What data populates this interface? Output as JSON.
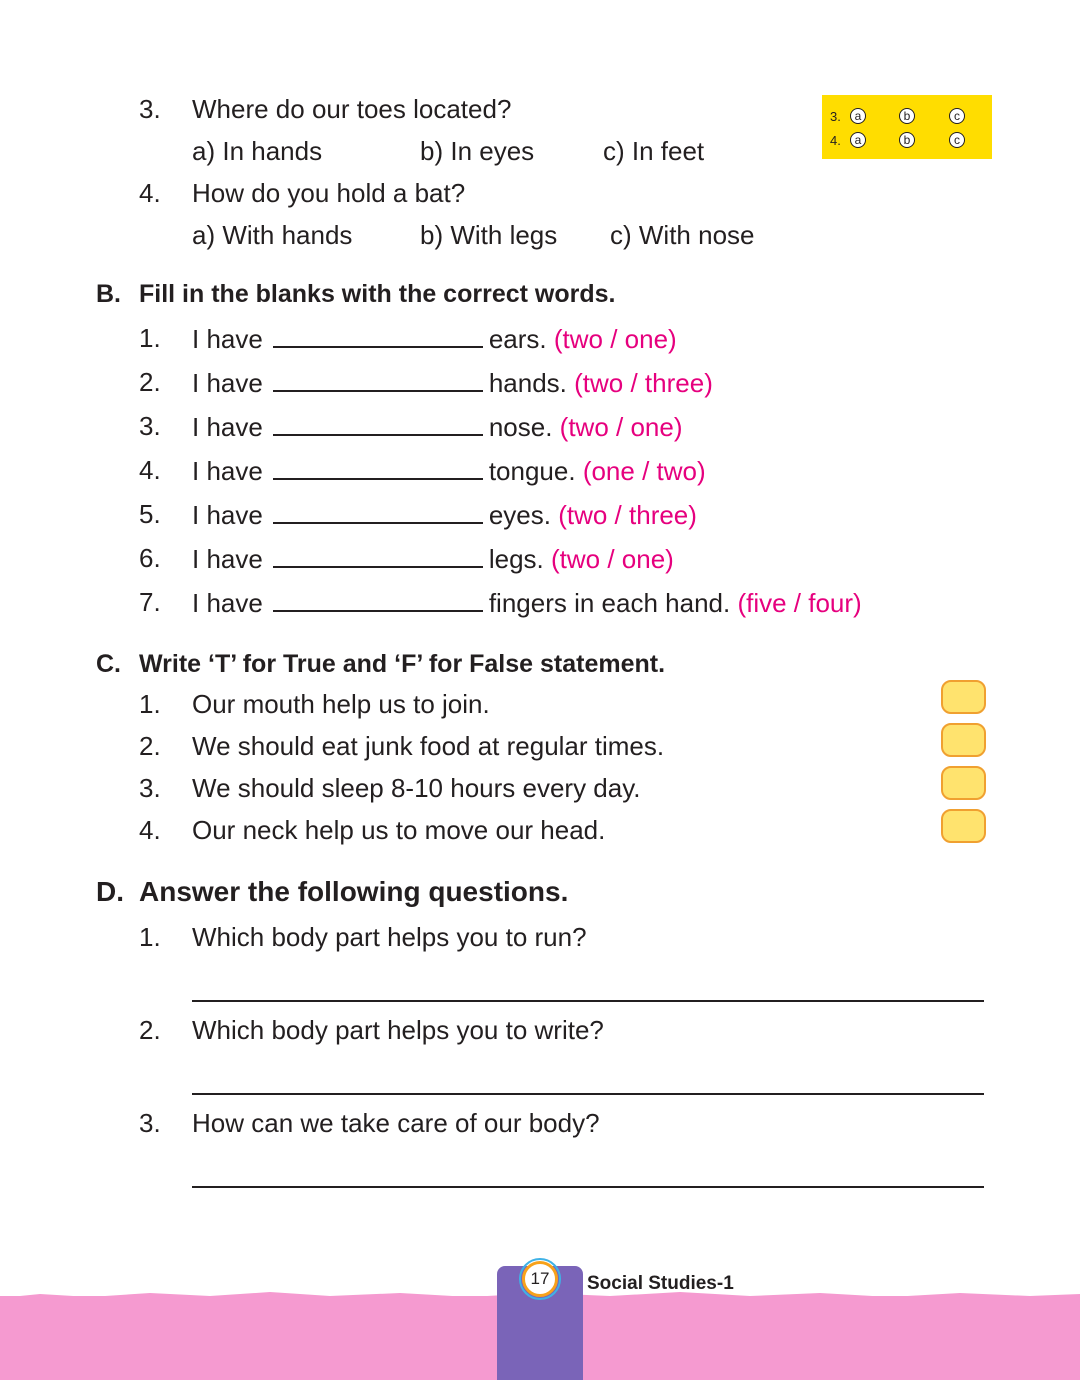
{
  "section_a": {
    "questions": [
      {
        "num": "3.",
        "text": "Where do our toes located?",
        "options": [
          "a) In hands",
          "b) In eyes",
          "c) In feet"
        ]
      },
      {
        "num": "4.",
        "text": "How do you hold a bat?",
        "options": [
          "a) With hands",
          "b) With legs",
          "c) With nose"
        ]
      }
    ],
    "answer_key": {
      "rows": [
        {
          "num": "3.",
          "bubbles": [
            "a",
            "b",
            "c"
          ]
        },
        {
          "num": "4.",
          "bubbles": [
            "a",
            "b",
            "c"
          ]
        }
      ]
    }
  },
  "section_b": {
    "letter": "B.",
    "title": "Fill in the blanks with the correct words.",
    "items": [
      {
        "num": "1.",
        "pre": "I have",
        "post": "ears.",
        "choice": "(two / one)"
      },
      {
        "num": "2.",
        "pre": "I have",
        "post": "hands.",
        "choice": "(two / three)"
      },
      {
        "num": "3.",
        "pre": "I have",
        "post": "nose.",
        "choice": "(two / one)"
      },
      {
        "num": "4.",
        "pre": "I have",
        "post": "tongue.",
        "choice": "(one / two)"
      },
      {
        "num": "5.",
        "pre": "I have",
        "post": "eyes.",
        "choice": "(two / three)"
      },
      {
        "num": "6.",
        "pre": "I have",
        "post": "legs.",
        "choice": "(two / one)"
      },
      {
        "num": "7.",
        "pre": "I have",
        "post": "fingers in each hand.",
        "choice": "(five / four)"
      }
    ]
  },
  "section_c": {
    "letter": "C.",
    "title": "Write ‘T’ for True and ‘F’ for False statement.",
    "items": [
      {
        "num": "1.",
        "text": "Our mouth help us to join."
      },
      {
        "num": "2.",
        "text": "We should eat junk food at regular times."
      },
      {
        "num": "3.",
        "text": "We should sleep 8-10 hours every day."
      },
      {
        "num": "4.",
        "text": "Our neck help us to move our head."
      }
    ]
  },
  "section_d": {
    "letter": "D.",
    "title": "Answer the following questions.",
    "items": [
      {
        "num": "1.",
        "text": "Which body part helps you to run?"
      },
      {
        "num": "2.",
        "text": "Which body part helps you to write?"
      },
      {
        "num": "3.",
        "text": "How can we take care of our body?"
      }
    ]
  },
  "footer": {
    "page_number": "17",
    "book_title": "Social Studies-1"
  },
  "colors": {
    "answer_key_bg": "#ffdd00",
    "choice_text": "#e6007e",
    "tf_box_fill": "#ffe36e",
    "footer_band": "#f59ad0",
    "footer_tab": "#7a64b8"
  }
}
